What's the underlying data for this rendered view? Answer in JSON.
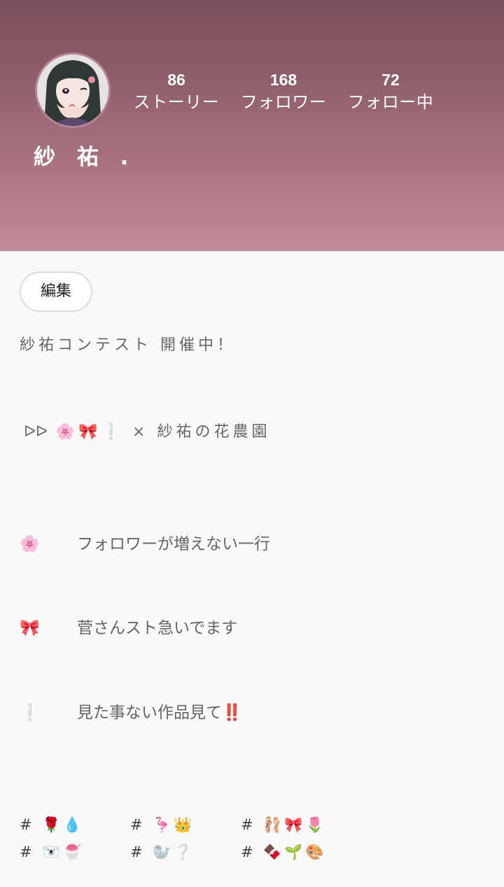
{
  "profile": {
    "name": "紗 祐 .",
    "edit_label": "編集"
  },
  "stats": {
    "stories": {
      "count": "86",
      "label": "ストーリー"
    },
    "followers": {
      "count": "168",
      "label": "フォロワー"
    },
    "following": {
      "count": "72",
      "label": "フォロー中"
    }
  },
  "bio": {
    "line1": "紗祐コンテスト  開催中！",
    "line2_prefix": "ᐅᐅ",
    "line2_emoji": "🌸🎀❕",
    "line2_text": " ×  紗祐の花農園",
    "rows": [
      {
        "emoji": "🌸",
        "text": "フォロワーが増えない一行"
      },
      {
        "emoji": "🎀",
        "text": "菅さんスト急いでます"
      },
      {
        "emoji": "❕",
        "text": "見た事ない作品見て‼️"
      }
    ],
    "tags": [
      "#  🌹💧",
      "#  🦩👑",
      "#  🩰🎀🌷",
      "#  🐻‍❄️🍧",
      "#  🦭❔",
      "#  🍫🌱🎨"
    ]
  },
  "colors": {
    "header_top": "#7b4f5b",
    "header_bottom": "#c28c98",
    "background": "#f9f9f9",
    "text_secondary": "#666666"
  },
  "icons": {
    "avatar": "avatar-image",
    "fast_forward": "fast-forward-icon"
  }
}
